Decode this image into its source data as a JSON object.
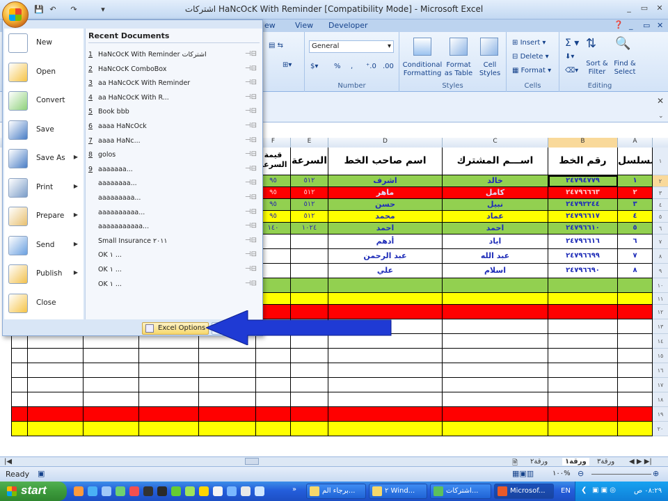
{
  "window": {
    "title": "HaNcOcK With Reminder  [Compatibility Mode] - Microsoft Excel",
    "title_prefix": "اشتركات"
  },
  "tabs": [
    "ew",
    "View",
    "Developer"
  ],
  "ribbon": {
    "number_format": "General",
    "number_label": "Number",
    "styles_label": "Styles",
    "cells_label": "Cells",
    "editing_label": "Editing",
    "conditional": "Conditional Formatting",
    "format_table": "Format as Table",
    "cell_styles": "Cell Styles",
    "insert": "Insert",
    "delete": "Delete",
    "format": "Format",
    "sort": "Sort & Filter",
    "find": "Find & Select",
    "percent": "%",
    "comma": ","
  },
  "office_menu": {
    "items": [
      {
        "label": "New",
        "name": "new"
      },
      {
        "label": "Open",
        "name": "open"
      },
      {
        "label": "Convert",
        "name": "convert"
      },
      {
        "label": "Save",
        "name": "save"
      },
      {
        "label": "Save As",
        "name": "save-as"
      },
      {
        "label": "Print",
        "name": "print"
      },
      {
        "label": "Prepare",
        "name": "prepare"
      },
      {
        "label": "Send",
        "name": "send"
      },
      {
        "label": "Publish",
        "name": "publish"
      },
      {
        "label": "Close",
        "name": "close"
      }
    ],
    "recent_header": "Recent Documents",
    "recent": [
      {
        "n": "1",
        "t": "HaNcOcK With Reminder اشتركات"
      },
      {
        "n": "2",
        "t": "HaNcOcK ComboBox"
      },
      {
        "n": "3",
        "t": "aa HaNcOcK With Reminder"
      },
      {
        "n": "4",
        "t": "aa HaNcOcK With R..."
      },
      {
        "n": "5",
        "t": "Book bbb"
      },
      {
        "n": "6",
        "t": "aaaa HaNcOck"
      },
      {
        "n": "7",
        "t": "aaaa HaNc..."
      },
      {
        "n": "8",
        "t": "golos"
      },
      {
        "n": "9",
        "t": "aaaaaaa..."
      },
      {
        "n": "",
        "t": "aaaaaaaa..."
      },
      {
        "n": "",
        "t": "aaaaaaaaa..."
      },
      {
        "n": "",
        "t": "aaaaaaaaaa..."
      },
      {
        "n": "",
        "t": "aaaaaaaaaaa..."
      },
      {
        "n": "",
        "t": "Small Insurance ٢٠١١"
      },
      {
        "n": "",
        "t": "OK ١ ..."
      },
      {
        "n": "",
        "t": "OK ١ ..."
      },
      {
        "n": "",
        "t": "OK ١ ..."
      }
    ],
    "options_label": "Excel Options"
  },
  "sheet": {
    "col_letters": [
      "F",
      "E",
      "D",
      "C",
      "B",
      "A"
    ],
    "headers": [
      "قيمة السرعة",
      "السرعة",
      "اسم صاحب الخط",
      "اســـم المشترك",
      "رقم الخط",
      "مسلسل"
    ],
    "rows": [
      {
        "color": "#92d050",
        "f": "٩٥",
        "e": "٥١٢",
        "d": "اشرف",
        "c": "خالد",
        "b": "٢٤٧٩٤٧٧٩",
        "a": "١"
      },
      {
        "color": "#ff0000",
        "f": "٩٥",
        "e": "٥١٢",
        "d": "ماهر",
        "c": "كامل",
        "b": "٢٤٧٩٦٦٦٣",
        "a": "٢"
      },
      {
        "color": "#92d050",
        "f": "٩٥",
        "e": "٥١٢",
        "d": "حسن",
        "c": "نبيل",
        "b": "٢٤٧٩٢٢٤٤",
        "a": "٣"
      },
      {
        "color": "#ffff00",
        "f": "٩٥",
        "e": "٥١٢",
        "d": "محمد",
        "c": "عماد",
        "b": "٢٤٧٩٦٦١٧",
        "a": "٤"
      },
      {
        "color": "#92d050",
        "f": "١٤٠",
        "e": "١٠٢٤",
        "d": "احمد",
        "c": "احمد",
        "b": "٢٤٧٩٦٦١٠",
        "a": "٥"
      },
      {
        "color": "#ffffff",
        "f": "",
        "e": "",
        "d": "أدهم",
        "c": "اياد",
        "b": "٢٤٧٩٦٦١٦",
        "a": "٦"
      },
      {
        "color": "#ffffff",
        "f": "",
        "e": "",
        "d": "عبد الرحمن",
        "c": "عبد الله",
        "b": "٢٤٧٩٦٦٩٩",
        "a": "٧"
      },
      {
        "color": "#ffffff",
        "f": "",
        "e": "",
        "d": "علي",
        "c": "اسلام",
        "b": "٢٤٧٩٦٦٩٠",
        "a": "٨"
      }
    ],
    "row_numbers": [
      "١",
      "٢",
      "٣",
      "٤",
      "٥",
      "٦",
      "٧",
      "٨",
      "٩",
      "١٠",
      "١١",
      "١٢",
      "١٣",
      "١٤",
      "١٥",
      "١٦",
      "١٧",
      "١٨",
      "١٩",
      "٢٠"
    ],
    "extra_row_colors": [
      "#92d050",
      "#ffff00",
      "#ff0000",
      "#ffffff",
      "#ffffff",
      "#ffffff",
      "#ffffff",
      "#ffffff",
      "#ffffff",
      "#ff0000",
      "#ffff00"
    ]
  },
  "sheet_tabs": [
    "ورقة٢",
    "ورقة١",
    "ورقة٣"
  ],
  "status": {
    "ready": "Ready",
    "zoom": "١٠٠%"
  },
  "taskbar": {
    "start": "start",
    "buttons": [
      "برجاء الم...",
      "٢ Wind...",
      "اشتركات...",
      "Microsof..."
    ],
    "lang": "EN",
    "clock": "٠٨:٢٩ ص"
  }
}
